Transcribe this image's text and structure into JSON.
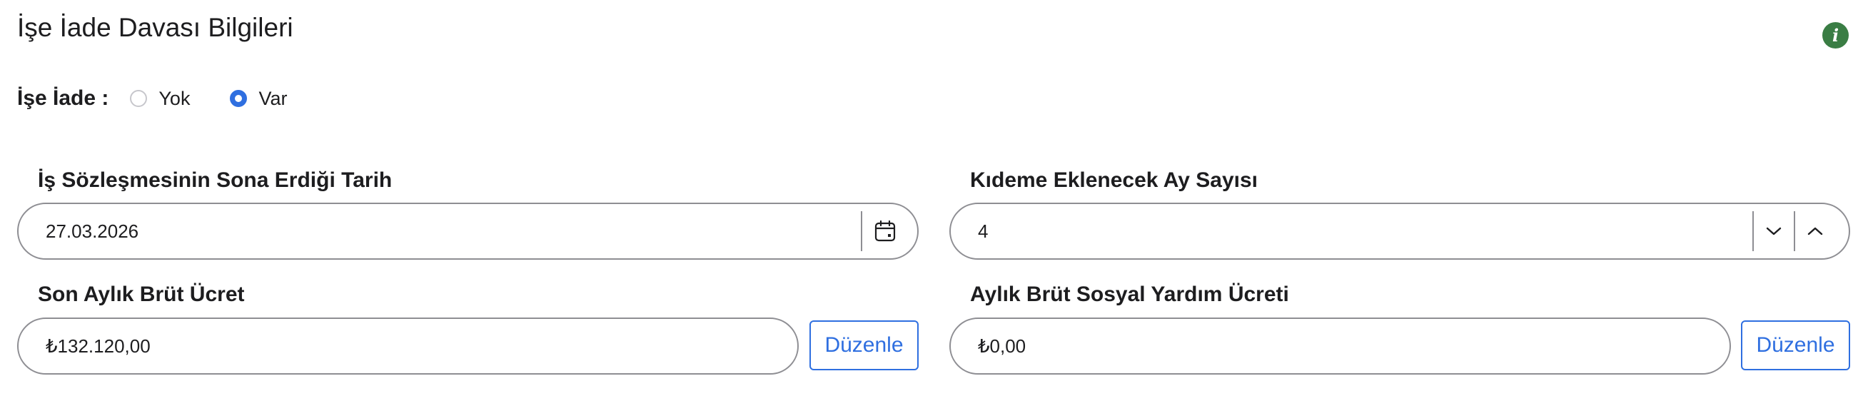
{
  "section": {
    "title": "İşe İade Davası Bilgileri",
    "info_icon": "info-icon"
  },
  "reinstatement": {
    "label": "İşe İade :",
    "options": [
      {
        "label": "Yok",
        "selected": false
      },
      {
        "label": "Var",
        "selected": true
      }
    ]
  },
  "contract_end_date": {
    "label": "İş Sözleşmesinin Sona Erdiği Tarih",
    "value": "27.03.2026",
    "icon": "calendar-icon"
  },
  "seniority_months": {
    "label": "Kıdeme Eklenecek Ay Sayısı",
    "value": "4",
    "decrement_icon": "chevron-down-icon",
    "increment_icon": "chevron-up-icon"
  },
  "last_gross_salary": {
    "label": "Son Aylık Brüt Ücret",
    "value": "₺132.120,00",
    "edit_label": "Düzenle"
  },
  "social_aid": {
    "label": "Aylık Brüt Sosyal Yardım Ücreti",
    "value": "₺0,00",
    "edit_label": "Düzenle"
  },
  "colors": {
    "accent": "#2f6fe0",
    "info": "#3a7d44",
    "border": "#8e8e93"
  }
}
